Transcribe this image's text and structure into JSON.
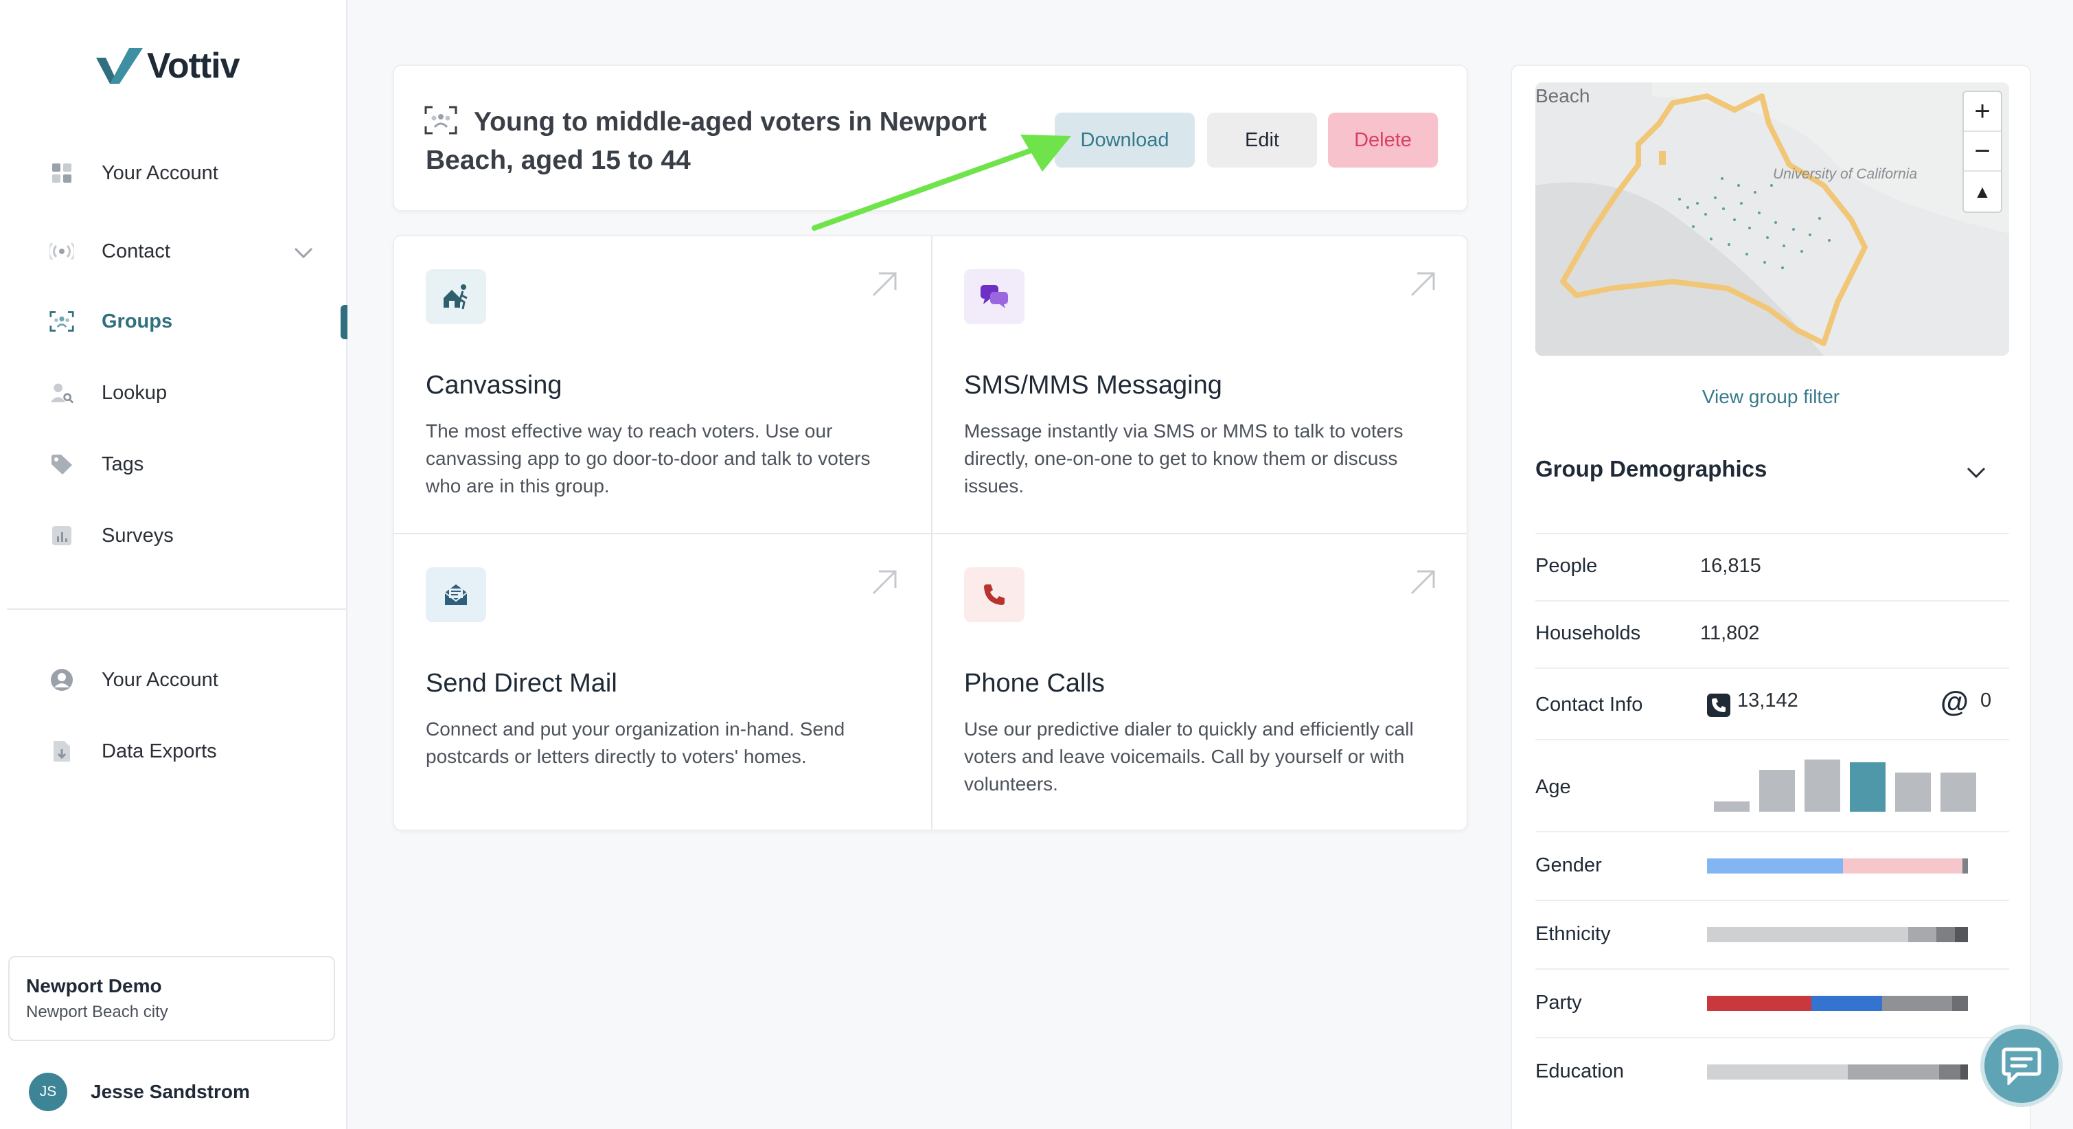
{
  "brand": {
    "name": "Vottiv",
    "accent": "#2f6f7f"
  },
  "sidebar": {
    "items": [
      {
        "label": "Your Account",
        "icon": "dashboard-icon"
      },
      {
        "label": "Contact",
        "icon": "broadcast-icon"
      },
      {
        "label": "Groups",
        "icon": "group-icon",
        "active": true
      },
      {
        "label": "Lookup",
        "icon": "person-search-icon"
      },
      {
        "label": "Tags",
        "icon": "tag-icon"
      },
      {
        "label": "Surveys",
        "icon": "chart-icon"
      }
    ],
    "bottom_items": [
      {
        "label": "Your Account",
        "icon": "user-circle-icon"
      },
      {
        "label": "Data Exports",
        "icon": "file-export-icon"
      }
    ],
    "org": {
      "name": "Newport Demo",
      "sub": "Newport Beach city"
    },
    "user": {
      "initials": "JS",
      "name": "Jesse Sandstrom"
    }
  },
  "header": {
    "title": "Young to middle-aged voters in Newport Beach, aged 15 to 44",
    "download_label": "Download",
    "edit_label": "Edit",
    "delete_label": "Delete"
  },
  "actions": [
    {
      "title": "Canvassing",
      "desc": "The most effective way to reach voters. Use our canvassing app to go door-to-door and talk to voters who are in this group.",
      "icon": "walk-house-icon"
    },
    {
      "title": "SMS/MMS Messaging",
      "desc": "Message instantly via SMS or MMS to talk to voters directly, one-on-one to get to know them or discuss issues.",
      "icon": "chat-bubbles-icon"
    },
    {
      "title": "Send Direct Mail",
      "desc": "Connect and put your organization in-hand. Send postcards or letters directly to voters' homes.",
      "icon": "mail-icon"
    },
    {
      "title": "Phone Calls",
      "desc": "Use our predictive dialer to quickly and efficiently call voters and leave voicemails. Call by yourself or with volunteers.",
      "icon": "phone-icon"
    }
  ],
  "map": {
    "label_beach": "Beach",
    "label_uc": "University of California",
    "zoom_in": "+",
    "zoom_out": "−",
    "compass": "▲"
  },
  "panel": {
    "view_filter": "View group filter",
    "demographics_title": "Group Demographics",
    "people_label": "People",
    "people_value": "16,815",
    "households_label": "Households",
    "households_value": "11,802",
    "contact_label": "Contact Info",
    "phone_count": "13,142",
    "email_count": "0",
    "age_label": "Age",
    "age_levels": [
      0.2,
      0.8,
      1.0,
      0.95,
      0.75,
      0.75
    ],
    "age_highlight_index": 3,
    "gender_label": "Gender",
    "gender_split": [
      0.52,
      0.46,
      0.02
    ],
    "ethnicity_label": "Ethnicity",
    "ethnicity_split": [
      0.77,
      0.11,
      0.07,
      0.05
    ],
    "party_label": "Party",
    "party_split": [
      0.4,
      0.27,
      0.27,
      0.06
    ],
    "education_label": "Education",
    "education_split": [
      0.54,
      0.35,
      0.08,
      0.03
    ]
  },
  "colors": {
    "age_bar": "#b8bcc1",
    "age_highlight": "#4f98aa",
    "gender": [
      "#82b5f2",
      "#f5c6ca",
      "#7d8188"
    ],
    "ethnicity": [
      "#cfd0d2",
      "#a7a9ac",
      "#7d7f82",
      "#545659"
    ],
    "party": [
      "#c9383d",
      "#3573d1",
      "#8f9194",
      "#6c6e71"
    ],
    "education": [
      "#d1d2d4",
      "#a7a9ac",
      "#7d7f82",
      "#545659"
    ]
  }
}
